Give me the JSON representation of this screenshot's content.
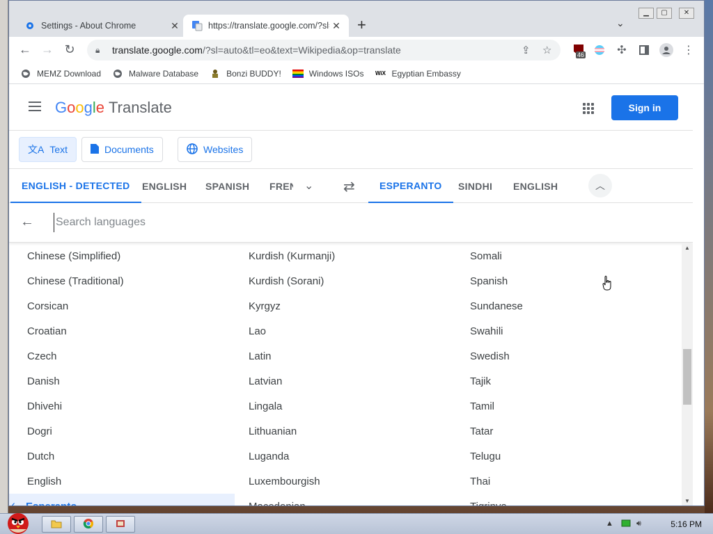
{
  "browser": {
    "tabs": [
      {
        "title": "Settings - About Chrome",
        "icon": "gear-icon"
      },
      {
        "title": "https://translate.google.com/?sl=",
        "icon": "translate-icon"
      }
    ],
    "url_host": "translate.google.com",
    "url_path": "/?sl=auto&tl=eo&text=Wikipedia&op=translate",
    "extension_badge": "46",
    "bookmarks": [
      {
        "label": "MEMZ Download",
        "icon": "globe-icon"
      },
      {
        "label": "Malware Database",
        "icon": "globe-icon"
      },
      {
        "label": "Bonzi BUDDY!",
        "icon": "bonzi-icon"
      },
      {
        "label": "Windows ISOs",
        "icon": "rainbow-flag-icon"
      },
      {
        "label": "Egyptian Embassy",
        "icon": "wix-icon"
      }
    ]
  },
  "header": {
    "logo_letters": [
      "G",
      "o",
      "o",
      "g",
      "l",
      "e"
    ],
    "product": "Translate",
    "signin": "Sign in"
  },
  "modes": [
    {
      "label": "Text",
      "icon": "translate-icon",
      "active": true
    },
    {
      "label": "Documents",
      "icon": "document-icon",
      "active": false
    },
    {
      "label": "Websites",
      "icon": "globe-icon",
      "active": false
    }
  ],
  "source_langs": [
    "ENGLISH - DETECTED",
    "ENGLISH",
    "SPANISH",
    "FREN"
  ],
  "target_langs": [
    "ESPERANTO",
    "SINDHI",
    "ENGLISH"
  ],
  "search": {
    "placeholder": "Search languages"
  },
  "languages": {
    "col1": [
      "Chinese (Simplified)",
      "Chinese (Traditional)",
      "Corsican",
      "Croatian",
      "Czech",
      "Danish",
      "Dhivehi",
      "Dogri",
      "Dutch",
      "English",
      "Esperanto"
    ],
    "col2": [
      "Kurdish (Kurmanji)",
      "Kurdish (Sorani)",
      "Kyrgyz",
      "Lao",
      "Latin",
      "Latvian",
      "Lingala",
      "Lithuanian",
      "Luganda",
      "Luxembourgish",
      "Macedonian"
    ],
    "col3": [
      "Somali",
      "Spanish",
      "Sundanese",
      "Swahili",
      "Swedish",
      "Tajik",
      "Tamil",
      "Tatar",
      "Telugu",
      "Thai",
      "Tigrinya"
    ],
    "selected": "Esperanto"
  },
  "taskbar": {
    "time": "5:16 PM"
  },
  "colors": {
    "accent": "#1a73e8",
    "selected_bg": "#e8f0fe"
  }
}
